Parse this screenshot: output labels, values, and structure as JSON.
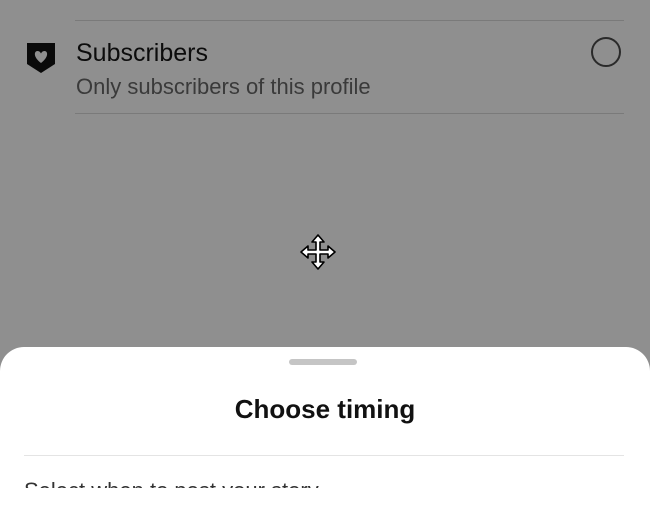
{
  "audience_option": {
    "title": "Subscribers",
    "subtitle": "Only subscribers of this profile",
    "icon": "subscriber-shield-icon",
    "selected": false
  },
  "sheet": {
    "title": "Choose timing",
    "body_text": "Select when to post your story"
  },
  "cursor": {
    "icon": "move-cursor-icon"
  },
  "colors": {
    "overlay": "#8f8f8f",
    "sheet_background": "#ffffff",
    "grabber": "#c5c5c5"
  }
}
